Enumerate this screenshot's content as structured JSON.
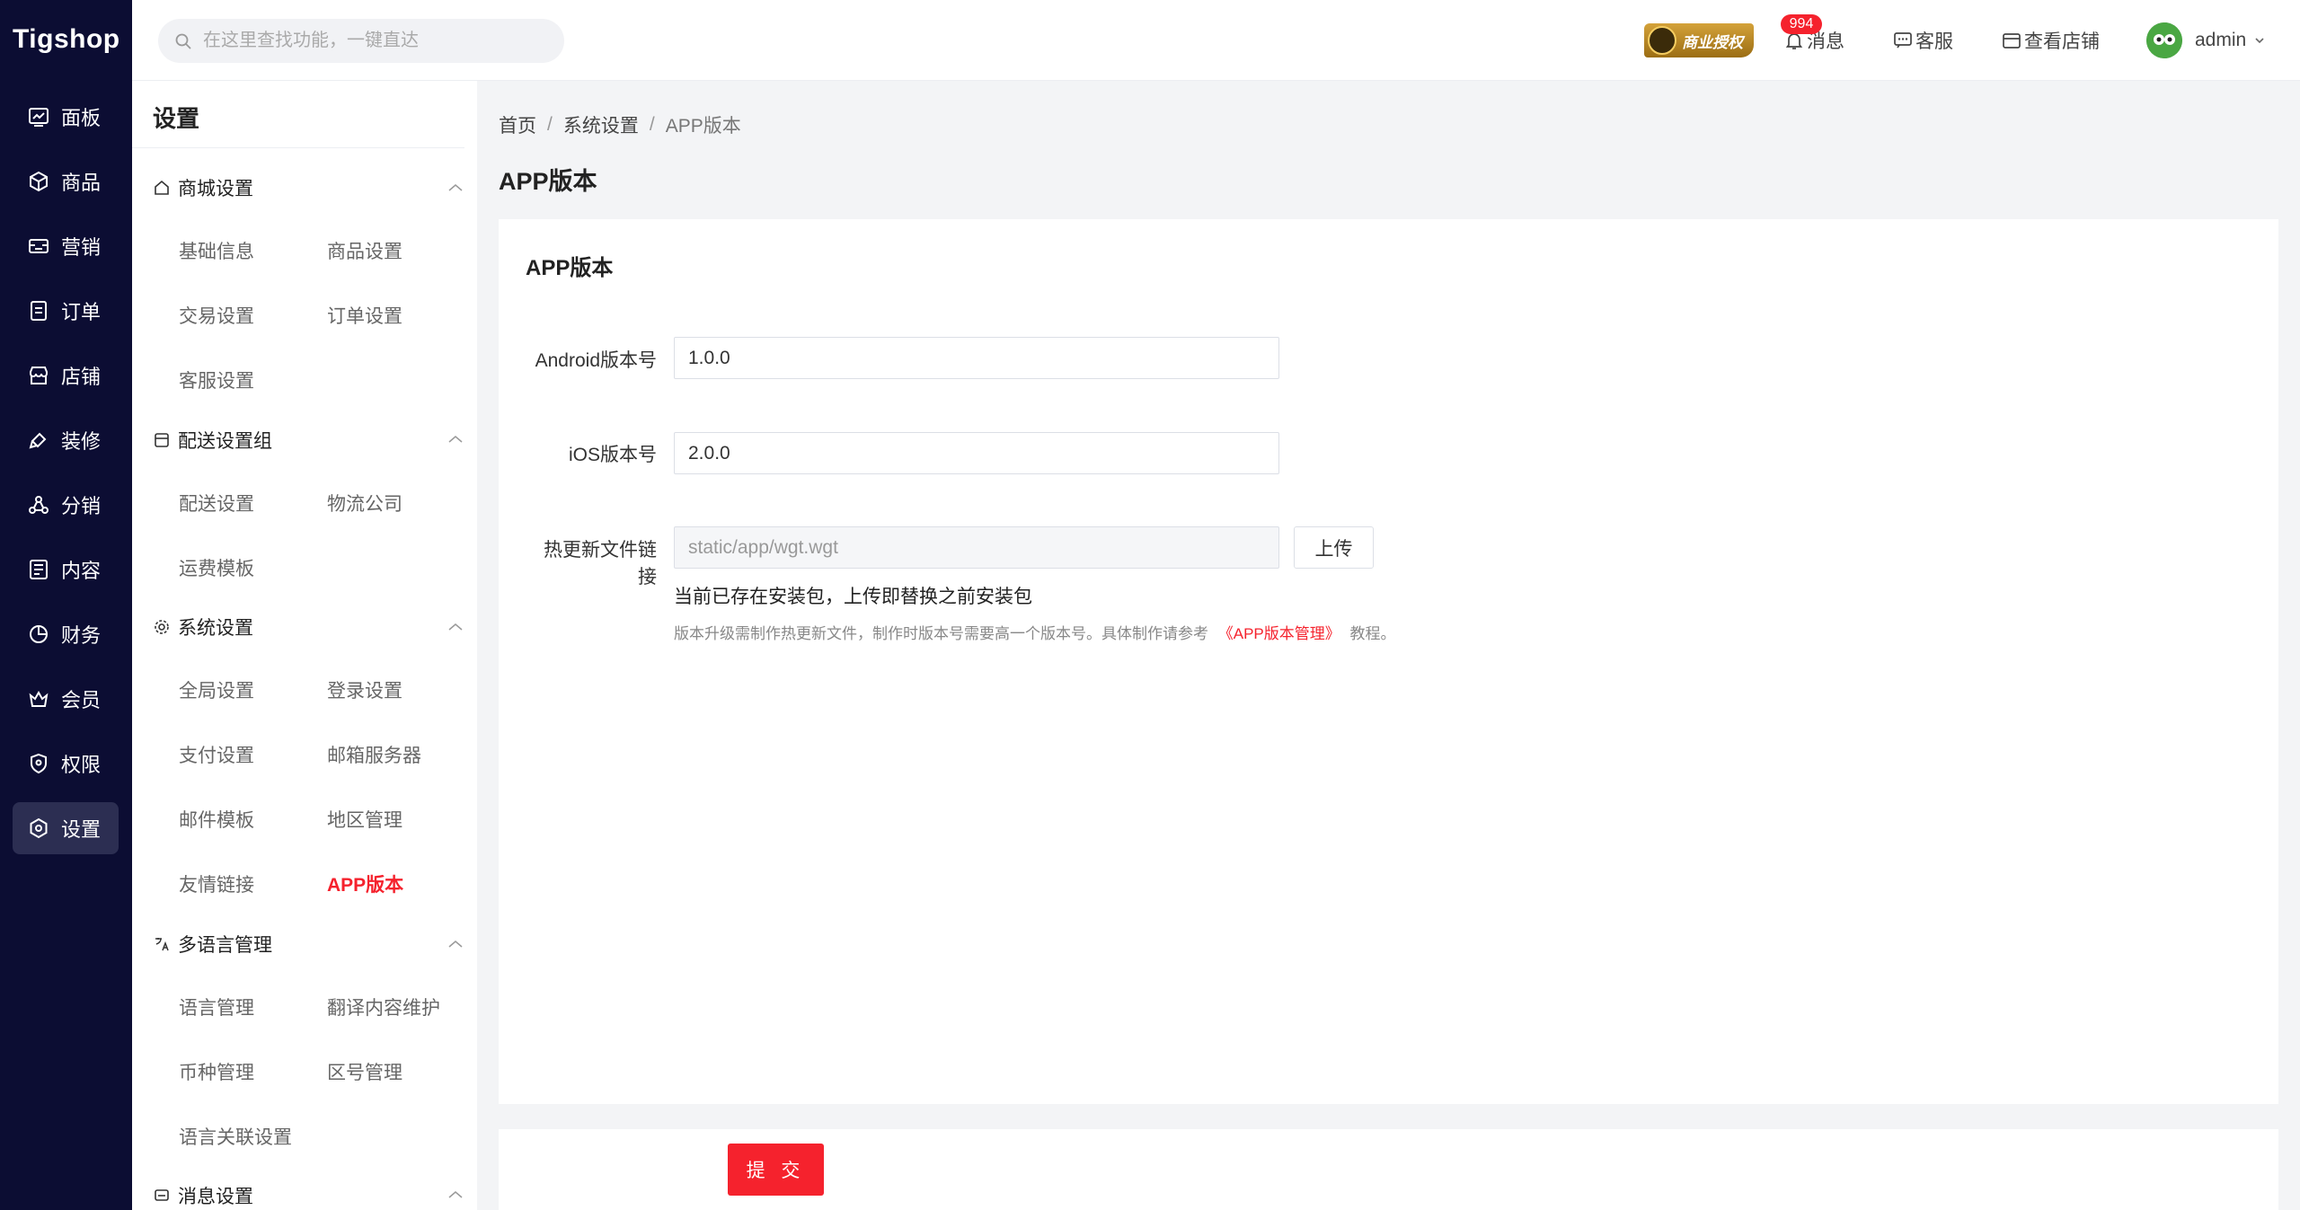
{
  "brand": {
    "logo_text": "Tigshop"
  },
  "search": {
    "placeholder": "在这里查找功能，一键直达"
  },
  "header": {
    "auth_badge": "商业授权",
    "message_count": "994",
    "messages_label": "消息",
    "service_label": "客服",
    "store_label": "查看店铺",
    "user_name": "admin"
  },
  "leftnav": {
    "items": [
      {
        "label": "面板",
        "icon": "dashboard-icon"
      },
      {
        "label": "商品",
        "icon": "box-icon"
      },
      {
        "label": "营销",
        "icon": "coupon-icon"
      },
      {
        "label": "订单",
        "icon": "order-icon"
      },
      {
        "label": "店铺",
        "icon": "store-icon"
      },
      {
        "label": "装修",
        "icon": "paint-icon"
      },
      {
        "label": "分销",
        "icon": "share-icon"
      },
      {
        "label": "内容",
        "icon": "content-icon"
      },
      {
        "label": "财务",
        "icon": "finance-icon"
      },
      {
        "label": "会员",
        "icon": "member-icon"
      },
      {
        "label": "权限",
        "icon": "shield-icon"
      },
      {
        "label": "设置",
        "icon": "settings-icon"
      }
    ]
  },
  "subnav": {
    "title": "设置",
    "groups": [
      {
        "label": "商城设置",
        "items": [
          "基础信息",
          "商品设置",
          "交易设置",
          "订单设置",
          "客服设置"
        ]
      },
      {
        "label": "配送设置组",
        "items": [
          "配送设置",
          "物流公司",
          "运费模板"
        ]
      },
      {
        "label": "系统设置",
        "items": [
          "全局设置",
          "登录设置",
          "支付设置",
          "邮箱服务器",
          "邮件模板",
          "地区管理",
          "友情链接",
          "APP版本"
        ]
      },
      {
        "label": "多语言管理",
        "items": [
          "语言管理",
          "翻译内容维护",
          "币种管理",
          "区号管理",
          "语言关联设置"
        ]
      },
      {
        "label": "消息设置",
        "items": []
      }
    ]
  },
  "breadcrumb": {
    "home": "首页",
    "parent": "系统设置",
    "current": "APP版本",
    "separator": "/"
  },
  "page": {
    "title": "APP版本"
  },
  "form": {
    "section_title": "APP版本",
    "android_label": "Android版本号",
    "android_value": "1.0.0",
    "ios_label": "iOS版本号",
    "ios_value": "2.0.0",
    "hotupdate_label": "热更新文件链接",
    "hotupdate_value": "static/app/wgt.wgt",
    "upload_label": "上传",
    "hint_exists": "当前已存在安装包，上传即替换之前安装包",
    "hint_prefix": "版本升级需制作热更新文件，制作时版本号需要高一个版本号。具体制作请参考",
    "hint_link": "《APP版本管理》",
    "hint_suffix": "教程。",
    "submit_label": "提 交"
  }
}
